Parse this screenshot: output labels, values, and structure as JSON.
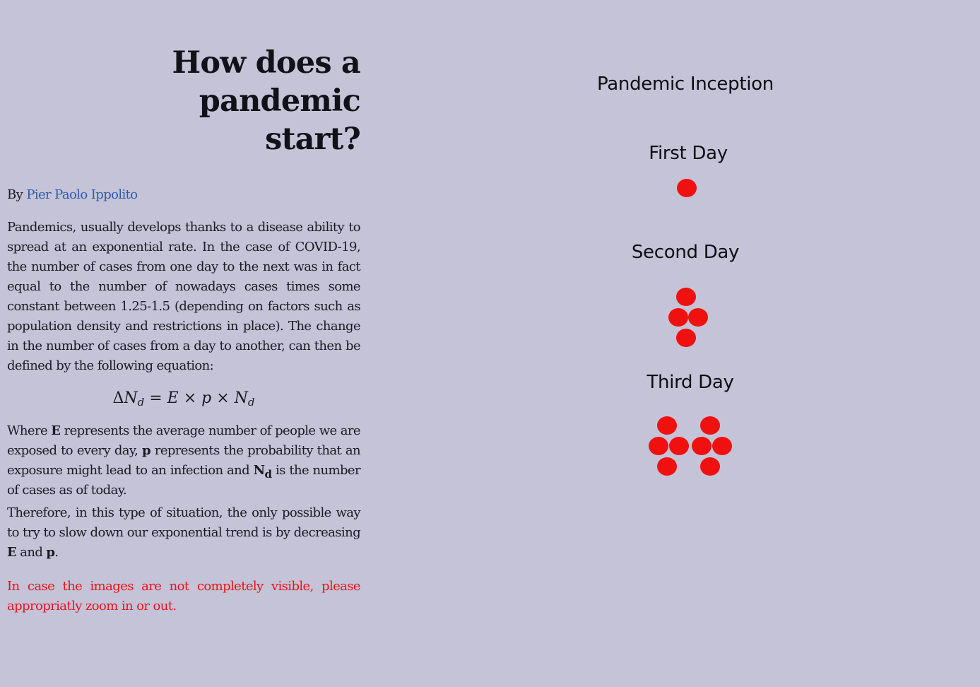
{
  "article": {
    "title_line1": "How does a pandemic",
    "title_line2": "start?",
    "byline_prefix": "By ",
    "author": "Pier Paolo Ippolito",
    "intro": "Pandemics, usually develops thanks to a disease ability to spread at an exponential rate. In the case of COVID-19, the number of cases from one day to the next was in fact equal to the number of nowadays cases times some constant between 1.25-1.5 (depending on factors such as population density and restrictions in place). The change in the number of cases from a day to another, can then be defined by the following equation:",
    "equation": {
      "delta": "Δ",
      "n": "N",
      "sub": "d",
      "eq": " = ",
      "e": "E",
      "times": " × ",
      "p": "p"
    },
    "where": {
      "t1": "Where ",
      "e": "E",
      "t2": " represents the average number of people we are exposed to every day, ",
      "p": "p",
      "t3": " represents the probability that an exposure might lead to an infection and ",
      "n": "N",
      "sub": "d",
      "t4": " is the number of cases as of today."
    },
    "therefore": {
      "t1": "Therefore, in this type of situation, the only possible way to try to slow down our exponential trend is by decreasing ",
      "e": "E",
      "t2": " and ",
      "p": "p",
      "t3": "."
    },
    "warning": "In case the images are not completely visible, please appropriatly zoom in or out."
  },
  "figure": {
    "title": "Pandemic Inception",
    "days": [
      {
        "label": "First Day",
        "cases": 1
      },
      {
        "label": "Second Day",
        "cases": 4
      },
      {
        "label": "Third Day",
        "cases": 8
      }
    ],
    "dot_color": "#f01010"
  }
}
